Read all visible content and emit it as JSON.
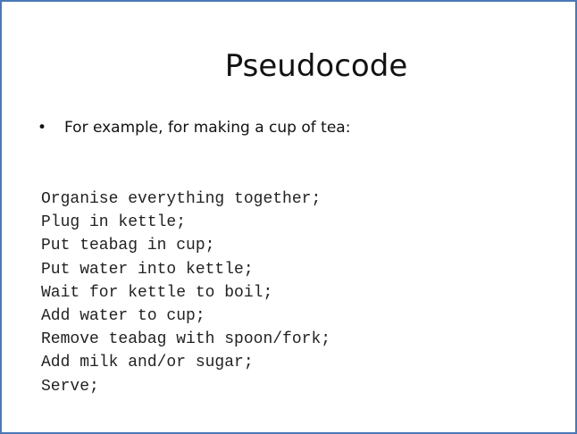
{
  "slide": {
    "title": "Pseudocode",
    "bullet_symbol": "•",
    "bullet_text": "For example, for making a cup of tea:",
    "code_lines": [
      "Organise everything together;",
      "Plug in kettle;",
      "Put teabag in cup;",
      "Put water into kettle;",
      "Wait for kettle to boil;",
      "Add water to cup;",
      "Remove teabag with spoon/fork;",
      "Add milk and/or sugar;",
      "Serve;"
    ],
    "colors": {
      "border": "#4a78b8",
      "background": "#ffffff",
      "text": "#111111"
    }
  }
}
